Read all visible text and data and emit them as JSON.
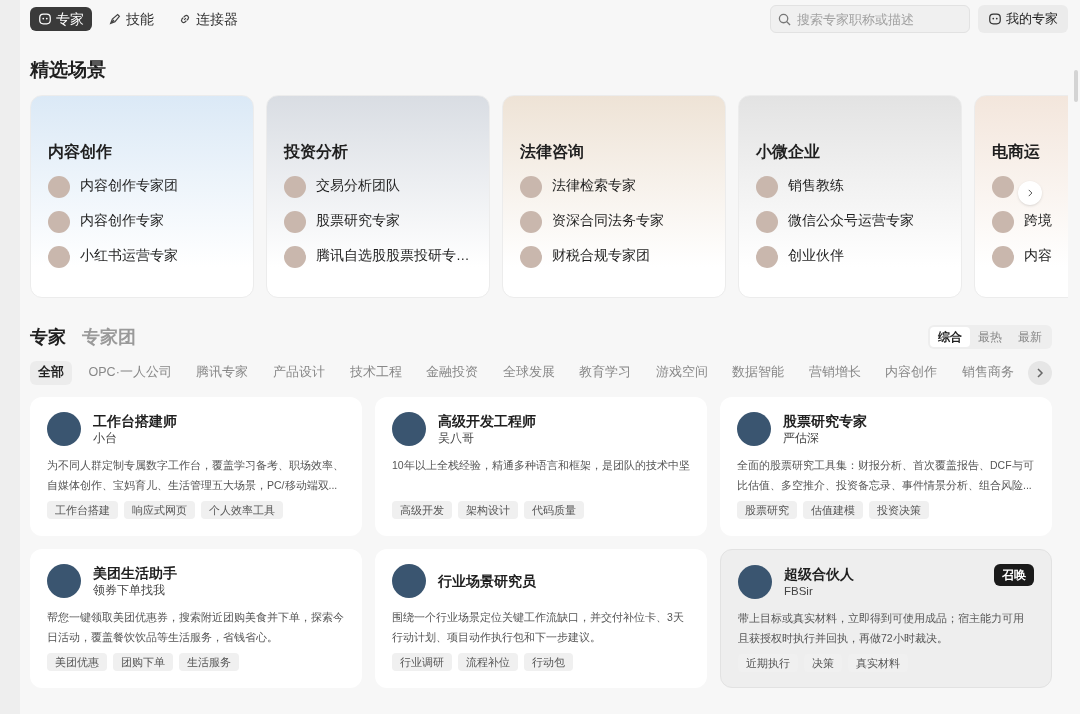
{
  "nav": {
    "tabs": [
      {
        "label": "专家",
        "selected": true
      },
      {
        "label": "技能",
        "selected": false
      },
      {
        "label": "连接器",
        "selected": false
      }
    ],
    "search": {
      "placeholder": "搜索专家职称或描述"
    },
    "my_button": "我的专家"
  },
  "featured": {
    "title": "精选场景",
    "scenes": [
      {
        "title": "内容创作",
        "items": [
          {
            "text": "内容创作专家团"
          },
          {
            "text": "内容创作专家"
          },
          {
            "text": "小红书运营专家"
          }
        ]
      },
      {
        "title": "投资分析",
        "items": [
          {
            "text": "交易分析团队"
          },
          {
            "text": "股票研究专家"
          },
          {
            "text": "腾讯自选股股票投研专…"
          }
        ]
      },
      {
        "title": "法律咨询",
        "items": [
          {
            "text": "法律检索专家"
          },
          {
            "text": "资深合同法务专家"
          },
          {
            "text": "财税合规专家团"
          }
        ]
      },
      {
        "title": "小微企业",
        "items": [
          {
            "text": "销售教练"
          },
          {
            "text": "微信公众号运营专家"
          },
          {
            "text": "创业伙伴"
          }
        ]
      },
      {
        "title": "电商运",
        "items": [
          {
            "text": "跨境"
          },
          {
            "text": "内容"
          }
        ]
      }
    ]
  },
  "experts": {
    "section_tabs": [
      {
        "label": "专家",
        "selected": true
      },
      {
        "label": "专家团",
        "selected": false
      }
    ],
    "sort": [
      {
        "label": "综合",
        "selected": true
      },
      {
        "label": "最热",
        "selected": false
      },
      {
        "label": "最新",
        "selected": false
      }
    ],
    "categories": [
      {
        "label": "全部",
        "selected": true
      },
      {
        "label": "OPC·一人公司",
        "selected": false
      },
      {
        "label": "腾讯专家",
        "selected": false
      },
      {
        "label": "产品设计",
        "selected": false
      },
      {
        "label": "技术工程",
        "selected": false
      },
      {
        "label": "金融投资",
        "selected": false
      },
      {
        "label": "全球发展",
        "selected": false
      },
      {
        "label": "教育学习",
        "selected": false
      },
      {
        "label": "游戏空间",
        "selected": false
      },
      {
        "label": "数据智能",
        "selected": false
      },
      {
        "label": "营销增长",
        "selected": false
      },
      {
        "label": "内容创作",
        "selected": false
      },
      {
        "label": "销售商务",
        "selected": false
      }
    ],
    "cards": [
      {
        "title": "工作台搭建师",
        "author": "小台",
        "description": "为不同人群定制专属数字工作台，覆盖学习备考、职场效率、自媒体创作、宝妈育儿、生活管理五大场景，PC/移动端双...",
        "tags": [
          "工作台搭建",
          "响应式网页",
          "个人效率工具"
        ],
        "highlighted": false
      },
      {
        "title": "高级开发工程师",
        "author": "吴八哥",
        "description": "10年以上全栈经验，精通多种语言和框架，是团队的技术中坚",
        "tags": [
          "高级开发",
          "架构设计",
          "代码质量"
        ],
        "highlighted": false
      },
      {
        "title": "股票研究专家",
        "author": "严估深",
        "description": "全面的股票研究工具集：财报分析、首次覆盖报告、DCF与可比估值、多空推介、投资备忘录、事件情景分析、组合风险...",
        "tags": [
          "股票研究",
          "估值建模",
          "投资决策"
        ],
        "highlighted": false
      },
      {
        "title": "美团生活助手",
        "author": "领券下单找我",
        "description": "帮您一键领取美团优惠券，搜索附近团购美食并下单，探索今日活动，覆盖餐饮饮品等生活服务，省钱省心。",
        "tags": [
          "美团优惠",
          "团购下单",
          "生活服务"
        ],
        "highlighted": false
      },
      {
        "title": "行业场景研究员",
        "description": "围绕一个行业场景定位关键工作流缺口，并交付补位卡、3天行动计划、项目动作执行包和下一步建议。",
        "tags": [
          "行业调研",
          "流程补位",
          "行动包"
        ],
        "highlighted": false
      },
      {
        "title": "超级合伙人",
        "author": "FBSir",
        "description": "带上目标或真实材料，立即得到可使用成品；宿主能力可用且获授权时执行并回执，再做72小时裁决。",
        "tags": [
          "近期执行",
          "决策",
          "真实材料"
        ],
        "highlighted": true,
        "action": "召唤"
      }
    ]
  }
}
